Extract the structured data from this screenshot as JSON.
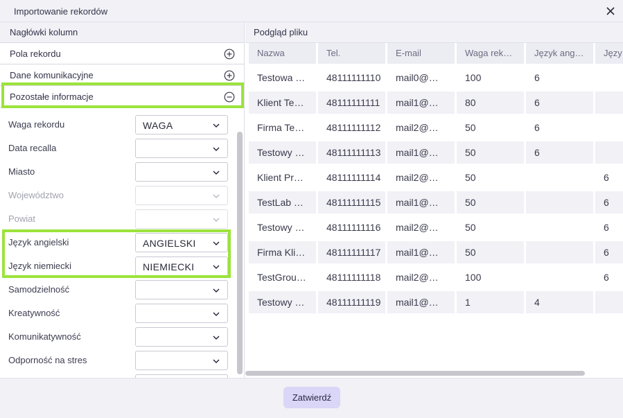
{
  "dialog": {
    "title": "Importowanie rekordów"
  },
  "left": {
    "header": "Nagłówki kolumn",
    "sections": [
      {
        "label": "Pola rekordu",
        "state": "collapsed"
      },
      {
        "label": "Dane komunikacyjne",
        "state": "collapsed"
      },
      {
        "label": "Pozostałe informacje",
        "state": "expanded"
      }
    ],
    "fields": [
      {
        "label": "Waga rekordu",
        "value": "WAGA",
        "disabled": false
      },
      {
        "label": "Data recalla",
        "value": "",
        "disabled": false
      },
      {
        "label": "Miasto",
        "value": "",
        "disabled": false
      },
      {
        "label": "Województwo",
        "value": "",
        "disabled": true
      },
      {
        "label": "Powiat",
        "value": "",
        "disabled": true
      },
      {
        "label": "Język angielski",
        "value": "ANGIELSKI",
        "disabled": false
      },
      {
        "label": "Język niemiecki",
        "value": "NIEMIECKI",
        "disabled": false
      },
      {
        "label": "Samodzielność",
        "value": "",
        "disabled": false
      },
      {
        "label": "Kreatywność",
        "value": "",
        "disabled": false
      },
      {
        "label": "Komunikatywność",
        "value": "",
        "disabled": false
      },
      {
        "label": "Odporność na stres",
        "value": "",
        "disabled": false
      }
    ]
  },
  "preview": {
    "header": "Podgląd pliku",
    "columns": [
      "Nazwa",
      "Tel.",
      "E-mail",
      "Waga rek…",
      "Język ang…",
      "Języ"
    ],
    "rows": [
      [
        "Testowa …",
        "48111111110",
        "mail0@…",
        "100",
        "6",
        ""
      ],
      [
        "Klient Te…",
        "48111111111",
        "mail1@…",
        "80",
        "6",
        ""
      ],
      [
        "Firma Te…",
        "48111111112",
        "mail2@…",
        "50",
        "6",
        ""
      ],
      [
        "Testowy …",
        "48111111113",
        "mail1@…",
        "50",
        "6",
        ""
      ],
      [
        "Klient Pr…",
        "48111111114",
        "mail2@…",
        "50",
        "",
        "6"
      ],
      [
        "TestLab …",
        "48111111115",
        "mail1@…",
        "50",
        "",
        "6"
      ],
      [
        "Testowy …",
        "48111111116",
        "mail2@…",
        "50",
        "",
        "6"
      ],
      [
        "Firma Kli…",
        "48111111117",
        "mail1@…",
        "50",
        "",
        "6"
      ],
      [
        "TestGrou…",
        "48111111118",
        "mail2@…",
        "100",
        "",
        "6"
      ],
      [
        "Testowy …",
        "48111111119",
        "mail1@…",
        "1",
        "4",
        ""
      ]
    ]
  },
  "footer": {
    "confirm_label": "Zatwierdź"
  },
  "colors": {
    "highlight": "#9be33b",
    "accent_button": "#d9d6f7",
    "panel_bg": "#f1f1f6"
  }
}
